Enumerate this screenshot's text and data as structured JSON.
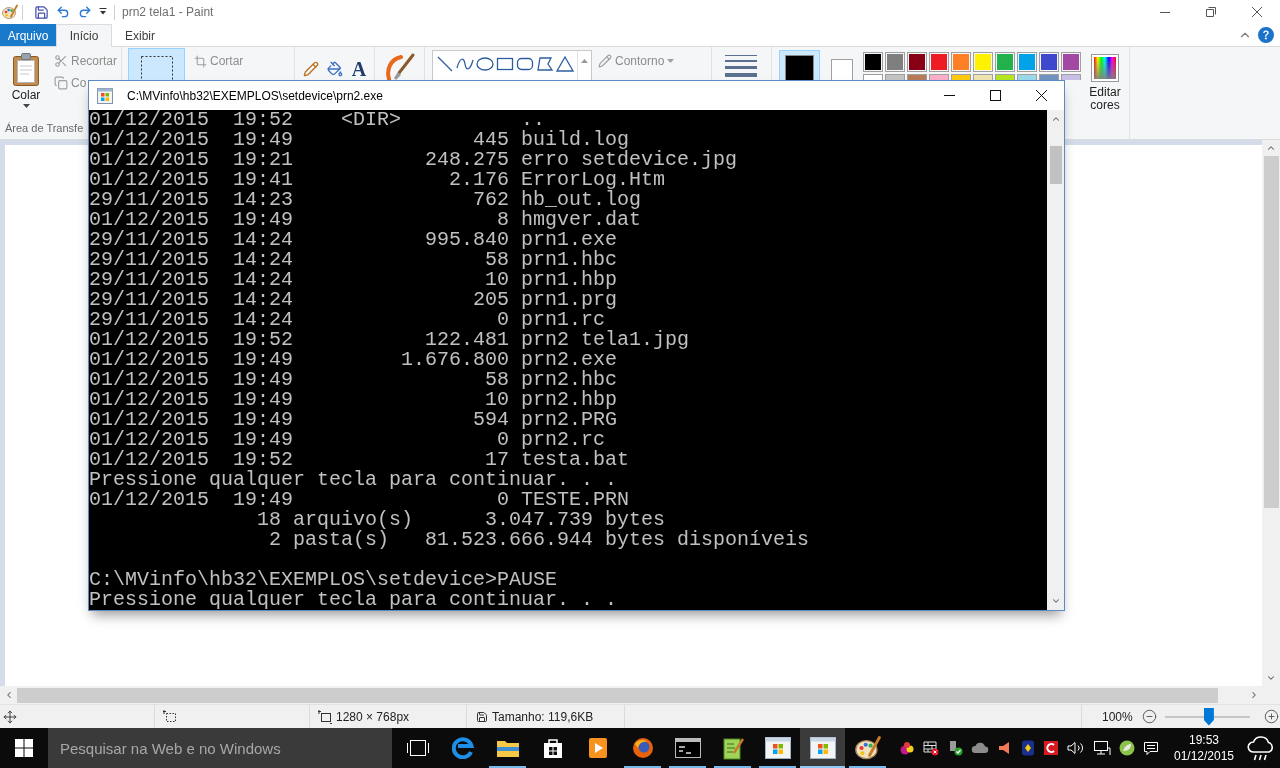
{
  "paint": {
    "title": "prn2 tela1 - Paint"
  },
  "ribbon": {
    "tabs": [
      {
        "label": "Arquivo",
        "kind": "file-menu",
        "selected": false
      },
      {
        "label": "Início",
        "kind": "tab",
        "selected": true
      },
      {
        "label": "Exibir",
        "kind": "tab",
        "selected": false
      }
    ],
    "clipboard": {
      "paste": "Colar",
      "cut": {
        "label": "Recortar",
        "disabled": true
      },
      "copy": {
        "label": "Co",
        "disabled": true
      },
      "group_label": "Área de Transfe"
    },
    "select_tool": {
      "selected": true
    },
    "crop": {
      "label": "Cortar",
      "disabled": true
    },
    "tools": [
      {
        "kind": "pencil",
        "selected": false
      },
      {
        "kind": "fill",
        "selected": false
      },
      {
        "kind": "text",
        "glyph": "A",
        "selected": false
      }
    ],
    "shapes": [
      {
        "kind": "line",
        "selected": false
      },
      {
        "kind": "curve",
        "selected": false
      },
      {
        "kind": "oval",
        "selected": false
      },
      {
        "kind": "rectangle",
        "selected": false
      },
      {
        "kind": "rounded-rectangle",
        "selected": false
      },
      {
        "kind": "polygon",
        "selected": false
      },
      {
        "kind": "triangle",
        "selected": false
      }
    ],
    "outline": {
      "label": "Contorno",
      "disabled": true
    },
    "colors": {
      "color1": {
        "color": "#000000",
        "selected": true
      },
      "color2": {
        "color": "#ffffff",
        "selected": false
      },
      "palette_rows": [
        {
          "swatches": [
            {
              "color": "#000000"
            },
            {
              "color": "#7f7f7f"
            },
            {
              "color": "#880015"
            },
            {
              "color": "#ed1c24"
            },
            {
              "color": "#ff7f27"
            },
            {
              "color": "#fff200"
            },
            {
              "color": "#22b14c"
            },
            {
              "color": "#00a2e8"
            },
            {
              "color": "#3f48cc"
            },
            {
              "color": "#a349a4"
            }
          ]
        },
        {
          "swatches": [
            {
              "color": "#ffffff"
            },
            {
              "color": "#c3c3c3"
            },
            {
              "color": "#b97a57"
            },
            {
              "color": "#ffaec9"
            },
            {
              "color": "#ffc90e"
            },
            {
              "color": "#efe4b0"
            },
            {
              "color": "#b5e61d"
            },
            {
              "color": "#99d9ea"
            },
            {
              "color": "#7092be"
            },
            {
              "color": "#c8bfe7"
            }
          ]
        }
      ],
      "edit_label": "Editar cores"
    }
  },
  "console": {
    "title": "C:\\MVinfo\\hb32\\EXEMPLOS\\setdevice\\prn2.exe",
    "lines": [
      {
        "kind": "dir",
        "date": "01/12/2015",
        "time": "19:52",
        "dir_label": "<DIR>",
        "name": ".."
      },
      {
        "kind": "file",
        "date": "01/12/2015",
        "time": "19:49",
        "size": "445",
        "name": "build.log"
      },
      {
        "kind": "file",
        "date": "01/12/2015",
        "time": "19:21",
        "size": "248.275",
        "name": "erro setdevice.jpg"
      },
      {
        "kind": "file",
        "date": "01/12/2015",
        "time": "19:41",
        "size": "2.176",
        "name": "ErrorLog.Htm"
      },
      {
        "kind": "file",
        "date": "29/11/2015",
        "time": "14:23",
        "size": "762",
        "name": "hb_out.log"
      },
      {
        "kind": "file",
        "date": "01/12/2015",
        "time": "19:49",
        "size": "8",
        "name": "hmgver.dat"
      },
      {
        "kind": "file",
        "date": "29/11/2015",
        "time": "14:24",
        "size": "995.840",
        "name": "prn1.exe"
      },
      {
        "kind": "file",
        "date": "29/11/2015",
        "time": "14:24",
        "size": "58",
        "name": "prn1.hbc"
      },
      {
        "kind": "file",
        "date": "29/11/2015",
        "time": "14:24",
        "size": "10",
        "name": "prn1.hbp"
      },
      {
        "kind": "file",
        "date": "29/11/2015",
        "time": "14:24",
        "size": "205",
        "name": "prn1.prg"
      },
      {
        "kind": "file",
        "date": "29/11/2015",
        "time": "14:24",
        "size": "0",
        "name": "prn1.rc"
      },
      {
        "kind": "file",
        "date": "01/12/2015",
        "time": "19:52",
        "size": "122.481",
        "name": "prn2 tela1.jpg"
      },
      {
        "kind": "file",
        "date": "01/12/2015",
        "time": "19:49",
        "size": "1.676.800",
        "name": "prn2.exe"
      },
      {
        "kind": "file",
        "date": "01/12/2015",
        "time": "19:49",
        "size": "58",
        "name": "prn2.hbc"
      },
      {
        "kind": "file",
        "date": "01/12/2015",
        "time": "19:49",
        "size": "10",
        "name": "prn2.hbp"
      },
      {
        "kind": "file",
        "date": "01/12/2015",
        "time": "19:49",
        "size": "594",
        "name": "prn2.PRG"
      },
      {
        "kind": "file",
        "date": "01/12/2015",
        "time": "19:49",
        "size": "0",
        "name": "prn2.rc"
      },
      {
        "kind": "file",
        "date": "01/12/2015",
        "time": "19:52",
        "size": "17",
        "name": "testa.bat"
      },
      {
        "kind": "message",
        "text": "Pressione qualquer tecla para continuar. . ."
      },
      {
        "kind": "file",
        "date": "01/12/2015",
        "time": "19:49",
        "size": "0",
        "name": "TESTE.PRN"
      },
      {
        "kind": "summary",
        "count": "18",
        "unit": "arquivo(s)",
        "size": "3.047.739",
        "suffix": "bytes"
      },
      {
        "kind": "summary",
        "count": "2",
        "unit": "pasta(s)",
        "size": "81.523.666.944",
        "suffix": "bytes disponíveis"
      },
      {
        "kind": "blank"
      },
      {
        "kind": "prompt",
        "text": "C:\\MVinfo\\hb32\\EXEMPLOS\\setdevice>PAUSE"
      },
      {
        "kind": "message",
        "text": "Pressione qualquer tecla para continuar. . ."
      }
    ]
  },
  "status_bar": {
    "dimensions": "1280 × 768px",
    "file_size": "Tamanho: 119,6KB",
    "zoom": "100%",
    "zoom_slider": {
      "level": 0.52
    }
  },
  "taskbar": {
    "search_placeholder": "Pesquisar na Web e no Windows",
    "apps": [
      {
        "kind": "task-view",
        "running": false,
        "selected": false
      },
      {
        "kind": "edge",
        "running": false,
        "selected": false
      },
      {
        "kind": "explorer",
        "running": true,
        "selected": false
      },
      {
        "kind": "store",
        "running": false,
        "selected": false
      },
      {
        "kind": "media",
        "running": false,
        "selected": false
      },
      {
        "kind": "firefox",
        "running": true,
        "selected": false
      },
      {
        "kind": "terminal",
        "running": true,
        "selected": false
      },
      {
        "kind": "notepad",
        "running": true,
        "selected": false
      },
      {
        "kind": "window-app",
        "running": true,
        "selected": false
      },
      {
        "kind": "window-app",
        "running": true,
        "selected": true
      },
      {
        "kind": "paint",
        "running": true,
        "selected": false
      }
    ],
    "time": "19:53",
    "date": "01/12/2015"
  }
}
